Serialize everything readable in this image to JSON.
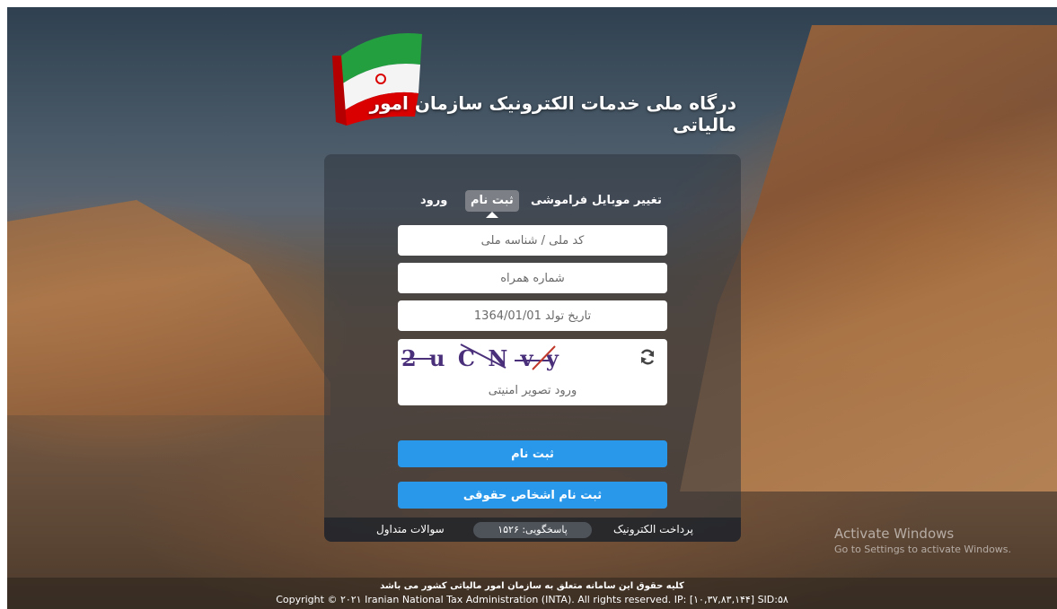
{
  "header": {
    "portal_title": "درگاه ملی خدمات الکترونیک سازمان امور مالیاتی"
  },
  "tabs": [
    {
      "label": "تغییر موبایل",
      "active": false
    },
    {
      "label": "فراموشی",
      "active": false
    },
    {
      "label": "ثبت نام",
      "active": true
    },
    {
      "label": "ورود",
      "active": false
    }
  ],
  "form": {
    "national_id_placeholder": "کد ملی / شناسه ملی",
    "mobile_placeholder": "شماره همراه",
    "birthdate_placeholder": "تاریخ تولد 1364/01/01",
    "captcha_text": "2 u C N v y",
    "captcha_placeholder": "ورود تصویر امنیتی",
    "register_button": "ثبت نام",
    "legal_register_button": "ثبت نام اشخاص حقوقی"
  },
  "panel_footer": {
    "payment_link": "پرداخت الکترونیک",
    "support": "پاسخگویی: ۱۵۲۶",
    "faq_link": "سوالات متداول"
  },
  "watermark": {
    "line1": "Activate Windows",
    "line2": "Go to Settings to activate Windows."
  },
  "copyright": {
    "persian": "کلیه حقوق این سامانه متعلق به سازمان امور مالیاتی کشور می باشد",
    "english": "Copyright © ۲۰۲۱ Iranian National Tax Administration (INTA). All rights reserved. IP: [۱۰,۳۷,۸۳,۱۴۴] SID:۵۸"
  },
  "colors": {
    "primary_button": "#2a98ea",
    "flag_green": "#239f40",
    "flag_red": "#da0000"
  }
}
